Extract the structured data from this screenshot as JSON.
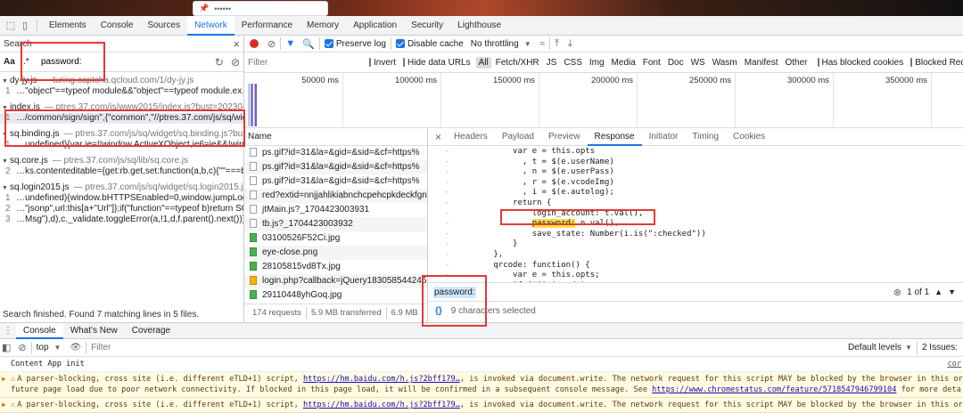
{
  "topbar": {
    "addr_text": "••••••",
    "tabs": [
      "Elements",
      "Console",
      "Sources",
      "Network",
      "Performance",
      "Memory",
      "Application",
      "Security",
      "Lighthouse"
    ],
    "active_tab": "Network"
  },
  "search": {
    "title": "Search",
    "case_btn": "Aa",
    "regex_btn": ".*",
    "query": "password:",
    "results": [
      {
        "file": "dy-jy.js",
        "path": "— turing.captcha.qcloud.com/1/dy-jy.js",
        "lines": [
          {
            "n": "1",
            "t": "…\"object\"==typeof module&&\"object\"==typeof module.ex…"
          }
        ]
      },
      {
        "file": "index.js",
        "path": "— ptres.37.com/js/www2015/index.js?bust=20230419…",
        "lines": [
          {
            "n": "1",
            "t": "…/common/sign/sign\",{\"common\",\"//ptres.37.com/js/sq/wid…"
          }
        ]
      },
      {
        "file": "sq.binding.js",
        "path": "— ptres.37.com/js/sq/widget/sq.binding.js?bust=…",
        "lines": [
          {
            "n": "1",
            "t": "…undefined){var ie=!!window.ActiveXObject,ie6=ie&&!wind…"
          }
        ]
      },
      {
        "file": "sq.core.js",
        "path": "— ptres.37.com/js/sq/lib/sq.core.js",
        "lines": [
          {
            "n": "2",
            "t": "…ks.contenteditable={get:rb.get,set:function(a,b,c){\"\"===b…"
          }
        ]
      },
      {
        "file": "sq.login2015.js",
        "path": "— ptres.37.com/js/sq/widget/sq.login2015.js?b…",
        "lines": [
          {
            "n": "1",
            "t": "…undefined){window.bHTTPSEnabled=0,window.jumpLogin…"
          },
          {
            "n": "2",
            "t": "…\"jsonp\",url:this[a+\"Url\"]};if(\"function\"==typeof b)return SQ…"
          },
          {
            "n": "3",
            "t": "…Msg\"),d),c._validate.toggleError(a,!1,d,f.parent().next())}else f…"
          }
        ]
      }
    ],
    "status": "Search finished.  Found 7 matching lines in 5 files."
  },
  "toolbar": {
    "preserve_log": "Preserve log",
    "disable_cache": "Disable cache",
    "throttling": "No throttling"
  },
  "filterbar": {
    "placeholder": "Filter",
    "invert": "Invert",
    "hide_data": "Hide data URLs",
    "types": [
      "All",
      "Fetch/XHR",
      "JS",
      "CSS",
      "Img",
      "Media",
      "Font",
      "Doc",
      "WS",
      "Wasm",
      "Manifest",
      "Other"
    ],
    "blocked_cookies": "Has blocked cookies",
    "blocked_requests": "Blocked Requ"
  },
  "timeline": {
    "ticks": [
      "50000 ms",
      "100000 ms",
      "150000 ms",
      "200000 ms",
      "250000 ms",
      "300000 ms",
      "350000 ms"
    ]
  },
  "requests": {
    "header": "Name",
    "items": [
      {
        "name": "ps.gif?id=31&la=&gid=&sid=&cf=https%",
        "icon": "doc"
      },
      {
        "name": "ps.gif?id=31&la=&gid=&sid=&cf=https%",
        "icon": "doc"
      },
      {
        "name": "ps.gif?id=31&la=&gid=&sid=&cf=https%",
        "icon": "doc"
      },
      {
        "name": "red?extid=nnjjahlikiabnchcpehcpkdeckfgn",
        "icon": "doc"
      },
      {
        "name": "jtMain.js?_1704423003931",
        "icon": "doc"
      },
      {
        "name": "tb.js?_1704423003932",
        "icon": "doc"
      },
      {
        "name": "03100526F52Ci.jpg",
        "icon": "img"
      },
      {
        "name": "eye-close.png",
        "icon": "img"
      },
      {
        "name": "28105815vd8Tx.jpg",
        "icon": "img"
      },
      {
        "name": "login.php?callback=jQuery183058544246…",
        "icon": "js"
      },
      {
        "name": "29110448yhGoq.jpg",
        "icon": "img"
      }
    ],
    "summary": [
      "174 requests",
      "5.9 MB transferred",
      "6.9 MB"
    ]
  },
  "detail": {
    "close": "×",
    "tabs": [
      "Headers",
      "Payload",
      "Preview",
      "Response",
      "Initiator",
      "Timing",
      "Cookies"
    ],
    "active_tab": "Response",
    "code": [
      {
        "g": "-",
        "t": "            var e = this.opts"
      },
      {
        "g": "-",
        "t": "              , t = $(e.userName)"
      },
      {
        "g": "-",
        "t": "              , n = $(e.userPass)"
      },
      {
        "g": "-",
        "t": "              , r = $(e.vcodeImg)"
      },
      {
        "g": "-",
        "t": "              , i = $(e.autolog);"
      },
      {
        "g": "-",
        "t": "            return {"
      },
      {
        "g": "-",
        "t": "                login_account: t.val(),"
      },
      {
        "g": "-",
        "pre": "                ",
        "hl": "password:",
        "post": " n.val(),"
      },
      {
        "g": "-",
        "t": "                save_state: Number(i.is(\":checked\"))"
      },
      {
        "g": "-",
        "t": "            }"
      },
      {
        "g": "-",
        "t": "        },"
      },
      {
        "g": "-",
        "t": "        qrcode: function() {"
      },
      {
        "g": "-",
        "t": "            var e = this.opts;"
      },
      {
        "g": "-",
        "t": "            if (!SQ.Qrcode)"
      }
    ],
    "find_value": "password:",
    "find_count": "1 of 1",
    "selection": "9 characters selected"
  },
  "drawer": {
    "tabs": [
      "Console",
      "What's New",
      "Coverage"
    ],
    "active_tab": "Console",
    "context": "top",
    "filter_placeholder": "Filter",
    "levels": "Default levels",
    "issues": "2 Issues:",
    "messages": [
      {
        "type": "info",
        "text": "Content App init",
        "src": "cor"
      },
      {
        "type": "warn",
        "text": "A parser-blocking, cross site (i.e. different eTLD+1) script, ",
        "link": "https://hm.baidu.com/h.js?2bff179…",
        "text2": ", is invoked via document.write. The network request for this script MAY be blocked by the browser in this or",
        "text3": "future page load due to poor network connectivity. If blocked in this page load, it will be confirmed in a subsequent console message. See ",
        "link2": "https://www.chromestatus.com/feature/5718547946799104",
        "text4": " for more deta"
      },
      {
        "type": "warn",
        "text": "A parser-blocking, cross site (i.e. different eTLD+1) script, ",
        "link": "https://hm.baidu.com/h.js?2bff179…",
        "text2": ", is invoked via document.write. The network request for this script MAY be blocked by the browser in this or"
      }
    ]
  },
  "colors": {
    "accent": "#1a73e8",
    "highlight_box": "#e53935",
    "search_match": "#f9e04b",
    "warn_bg": "#fffbe5"
  }
}
